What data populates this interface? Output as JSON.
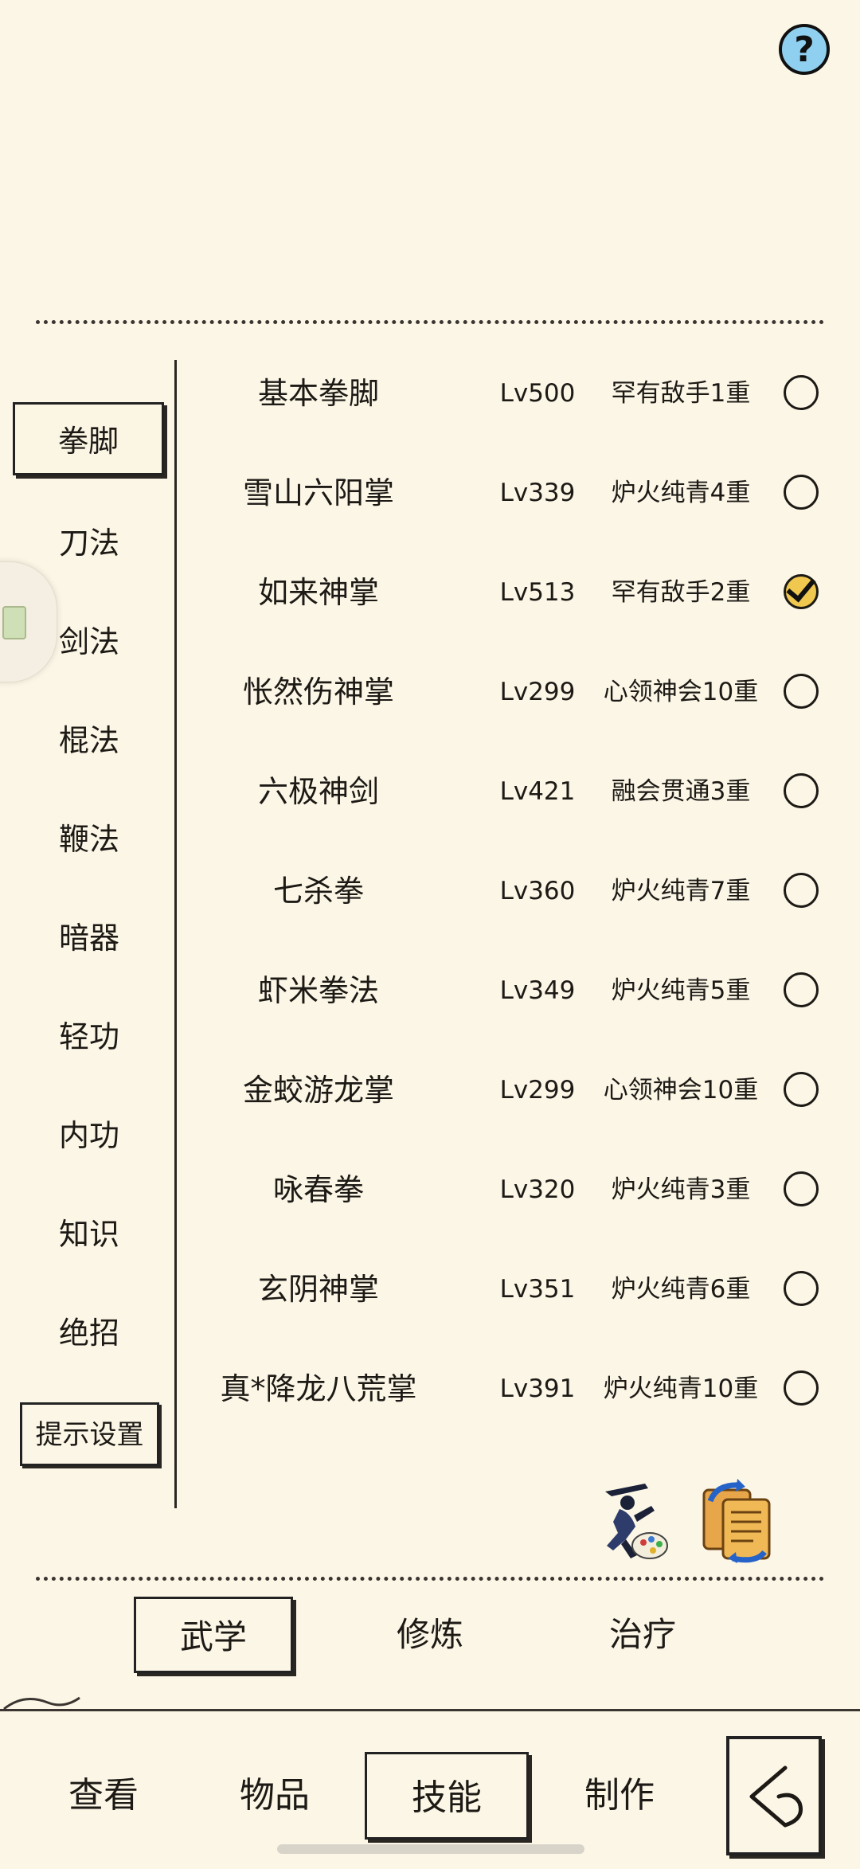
{
  "colors": {
    "background": "#fcf6e6",
    "ink": "#1d1a16",
    "help_button": "#8fd0f0",
    "checked_fill": "#f0c74f"
  },
  "help": {
    "label": "?"
  },
  "categories": [
    {
      "label": "拳脚"
    },
    {
      "label": "刀法"
    },
    {
      "label": "剑法"
    },
    {
      "label": "棍法"
    },
    {
      "label": "鞭法"
    },
    {
      "label": "暗器"
    },
    {
      "label": "轻功"
    },
    {
      "label": "内功"
    },
    {
      "label": "知识"
    },
    {
      "label": "绝招"
    }
  ],
  "settings_button": {
    "label": "提示设置"
  },
  "skills": [
    {
      "name": "基本拳脚",
      "level": "Lv500",
      "rank": "罕有敌手1重",
      "checked": false
    },
    {
      "name": "雪山六阳掌",
      "level": "Lv339",
      "rank": "炉火纯青4重",
      "checked": false
    },
    {
      "name": "如来神掌",
      "level": "Lv513",
      "rank": "罕有敌手2重",
      "checked": true
    },
    {
      "name": "怅然伤神掌",
      "level": "Lv299",
      "rank": "心领神会10重",
      "checked": false
    },
    {
      "name": "六极神剑",
      "level": "Lv421",
      "rank": "融会贯通3重",
      "checked": false
    },
    {
      "name": "七杀拳",
      "level": "Lv360",
      "rank": "炉火纯青7重",
      "checked": false
    },
    {
      "name": "虾米拳法",
      "level": "Lv349",
      "rank": "炉火纯青5重",
      "checked": false
    },
    {
      "name": "金蛟游龙掌",
      "level": "Lv299",
      "rank": "心领神会10重",
      "checked": false
    },
    {
      "name": "咏春拳",
      "level": "Lv320",
      "rank": "炉火纯青3重",
      "checked": false
    },
    {
      "name": "玄阴神掌",
      "level": "Lv351",
      "rank": "炉火纯青6重",
      "checked": false
    },
    {
      "name": "真*降龙八荒掌",
      "level": "Lv391",
      "rank": "炉火纯青10重",
      "checked": false
    }
  ],
  "actions": [
    {
      "icon": "martial-artist-painting-icon"
    },
    {
      "icon": "scroll-swap-icon"
    }
  ],
  "subtabs": [
    {
      "label": "武学"
    },
    {
      "label": "修炼"
    },
    {
      "label": "治疗"
    }
  ],
  "nav": [
    {
      "label": "查看"
    },
    {
      "label": "物品"
    },
    {
      "label": "技能"
    },
    {
      "label": "制作"
    }
  ],
  "back": {
    "icon": "back-arrow-icon"
  }
}
